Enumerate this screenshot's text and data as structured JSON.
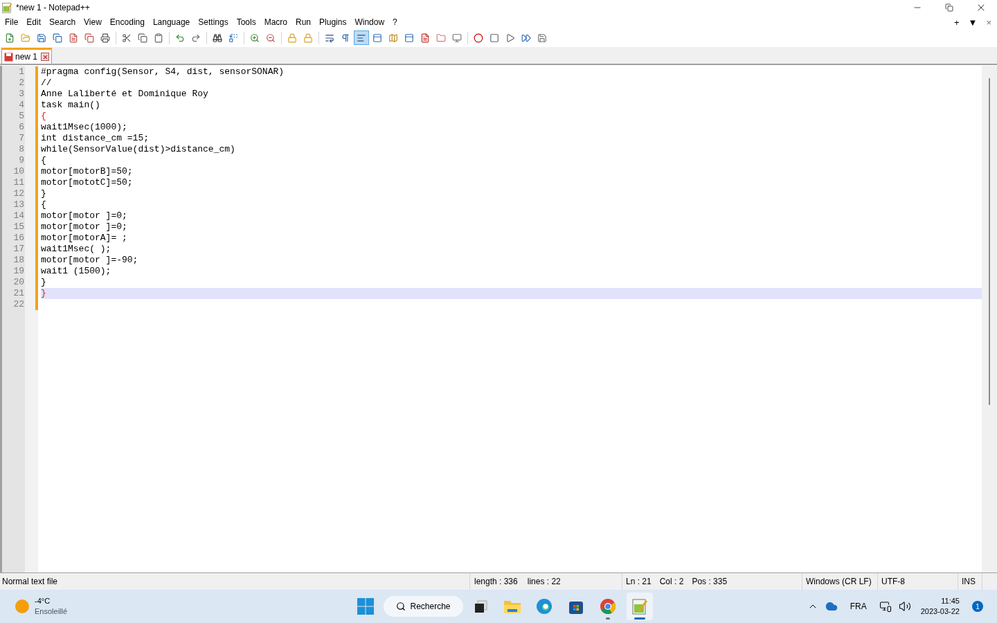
{
  "window": {
    "title": "*new 1 - Notepad++"
  },
  "menu": [
    "File",
    "Edit",
    "Search",
    "View",
    "Encoding",
    "Language",
    "Settings",
    "Tools",
    "Macro",
    "Run",
    "Plugins",
    "Window",
    "?"
  ],
  "tab_bar_controls": [
    "+",
    "▼",
    "×"
  ],
  "toolbar_groups": [
    [
      {
        "kind": "new",
        "pressed": false
      },
      {
        "kind": "open",
        "pressed": false
      },
      {
        "kind": "save",
        "pressed": false
      },
      {
        "kind": "saveall",
        "pressed": false
      },
      {
        "kind": "close",
        "pressed": false
      },
      {
        "kind": "closeall",
        "pressed": false
      },
      {
        "kind": "print",
        "pressed": false
      }
    ],
    [
      {
        "kind": "cut",
        "pressed": false
      },
      {
        "kind": "copy",
        "pressed": false
      },
      {
        "kind": "paste",
        "pressed": false
      }
    ],
    [
      {
        "kind": "undo",
        "pressed": false
      },
      {
        "kind": "redo",
        "pressed": false
      }
    ],
    [
      {
        "kind": "find",
        "pressed": false
      },
      {
        "kind": "replace",
        "pressed": false
      }
    ],
    [
      {
        "kind": "zoomin",
        "pressed": false
      },
      {
        "kind": "zoomout",
        "pressed": false
      }
    ],
    [
      {
        "kind": "sync",
        "pressed": false
      },
      {
        "kind": "sync",
        "pressed": false
      }
    ],
    [
      {
        "kind": "wrap",
        "pressed": false
      },
      {
        "kind": "pilcrow",
        "pressed": false
      },
      {
        "kind": "indent",
        "pressed": true
      },
      {
        "kind": "panel",
        "pressed": false
      },
      {
        "kind": "map",
        "pressed": false
      },
      {
        "kind": "panel",
        "pressed": false
      },
      {
        "kind": "doc",
        "pressed": false
      },
      {
        "kind": "folder",
        "pressed": false
      },
      {
        "kind": "monitor",
        "pressed": false
      }
    ],
    [
      {
        "kind": "record",
        "pressed": false
      },
      {
        "kind": "stop",
        "pressed": false
      },
      {
        "kind": "play",
        "pressed": false
      },
      {
        "kind": "playmany",
        "pressed": false
      },
      {
        "kind": "savemacro",
        "pressed": false
      }
    ]
  ],
  "tabs": [
    {
      "label": "new 1",
      "selected": true,
      "modified": true
    }
  ],
  "editor": {
    "lines": [
      {
        "number": "1",
        "text": "#pragma config(Sensor, S4, dist, sensorSONAR)",
        "brace_match": false,
        "current": false
      },
      {
        "number": "2",
        "text": "//",
        "brace_match": false,
        "current": false
      },
      {
        "number": "3",
        "text": "Anne Laliberté et Dominique Roy",
        "brace_match": false,
        "current": false
      },
      {
        "number": "4",
        "text": "task main()",
        "brace_match": false,
        "current": false
      },
      {
        "number": "5",
        "text": "{",
        "brace_match": true,
        "current": false
      },
      {
        "number": "6",
        "text": "wait1Msec(1000);",
        "brace_match": false,
        "current": false
      },
      {
        "number": "7",
        "text": "int distance_cm =15;",
        "brace_match": false,
        "current": false
      },
      {
        "number": "8",
        "text": "while(SensorValue(dist)>distance_cm)",
        "brace_match": false,
        "current": false
      },
      {
        "number": "9",
        "text": "{",
        "brace_match": false,
        "current": false
      },
      {
        "number": "10",
        "text": "motor[motorB]=50;",
        "brace_match": false,
        "current": false
      },
      {
        "number": "11",
        "text": "motor[mototC]=50;",
        "brace_match": false,
        "current": false
      },
      {
        "number": "12",
        "text": "}",
        "brace_match": false,
        "current": false
      },
      {
        "number": "13",
        "text": "{",
        "brace_match": false,
        "current": false
      },
      {
        "number": "14",
        "text": "motor[motor ]=0;",
        "brace_match": false,
        "current": false
      },
      {
        "number": "15",
        "text": "motor[motor ]=0;",
        "brace_match": false,
        "current": false
      },
      {
        "number": "16",
        "text": "motor[motorA]= ;",
        "brace_match": false,
        "current": false
      },
      {
        "number": "17",
        "text": "wait1Msec( );",
        "brace_match": false,
        "current": false
      },
      {
        "number": "18",
        "text": "motor[motor ]=-90;",
        "brace_match": false,
        "current": false
      },
      {
        "number": "19",
        "text": "wait1 (1500);",
        "brace_match": false,
        "current": false
      },
      {
        "number": "20",
        "text": "}",
        "brace_match": false,
        "current": false
      },
      {
        "number": "21",
        "text": "}",
        "brace_match": true,
        "current": true
      },
      {
        "number": "22",
        "current": false
      }
    ]
  },
  "status_bar": {
    "file_type": "Normal text file",
    "length": "length : 336",
    "lines": "lines : 22",
    "ln": "Ln : 21",
    "col": "Col : 2",
    "pos": "Pos : 335",
    "eol": "Windows (CR LF)",
    "encoding": "UTF-8",
    "mode": "INS"
  },
  "taskbar": {
    "weather": {
      "temp": "-4°C",
      "condition": "Ensoleillé"
    },
    "search": "Recherche",
    "apps": [
      {
        "kind": "files",
        "selected": false,
        "running": false
      },
      {
        "kind": "browser",
        "selected": false,
        "running": false
      },
      {
        "kind": "store",
        "selected": false,
        "running": false
      },
      {
        "kind": "chrome",
        "selected": false,
        "running": true
      },
      {
        "kind": "notepad",
        "selected": true,
        "running": true
      }
    ],
    "language": "FRA",
    "time": "11:45",
    "date": "2023-03-22",
    "notifications": "1"
  }
}
